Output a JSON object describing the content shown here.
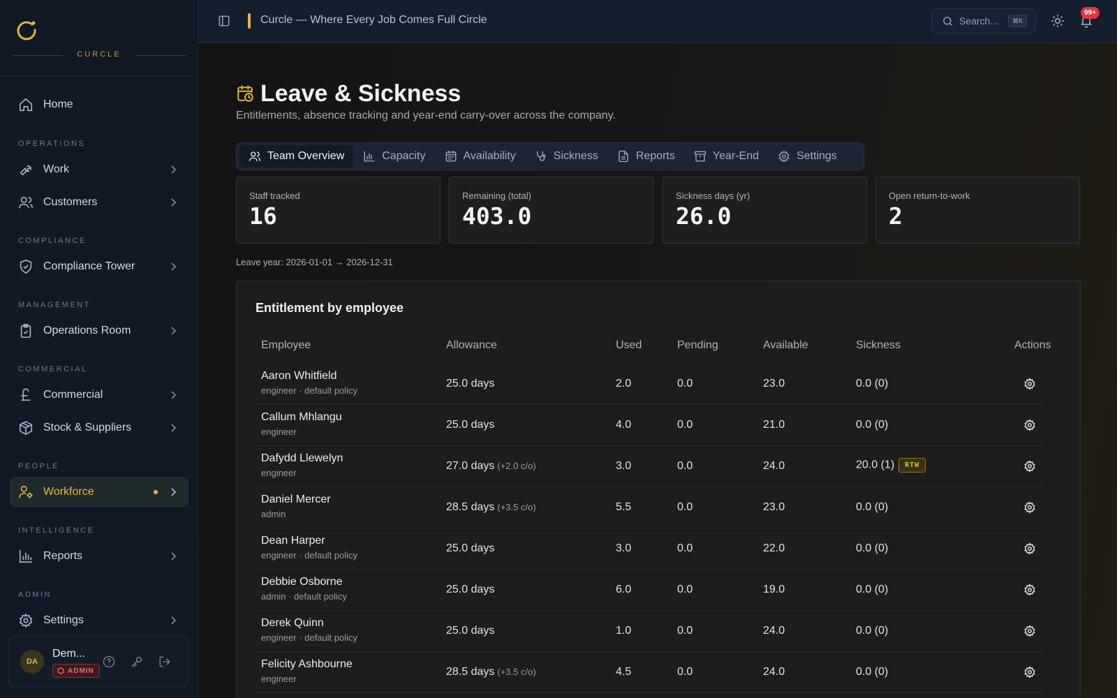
{
  "app": {
    "brand_name": "CURCLE",
    "window_title": "Curcle — Where Every Job Comes Full Circle"
  },
  "sidebar": {
    "home": "Home",
    "sections": {
      "operations": "OPERATIONS",
      "compliance": "COMPLIANCE",
      "management": "MANAGEMENT",
      "commercial": "COMMERCIAL",
      "people": "PEOPLE",
      "intelligence": "INTELLIGENCE",
      "admin": "ADMIN"
    },
    "items": {
      "work": "Work",
      "customers": "Customers",
      "compliance_tower": "Compliance Tower",
      "operations_room": "Operations Room",
      "commercial": "Commercial",
      "stock_suppliers": "Stock & Suppliers",
      "workforce": "Workforce",
      "reports": "Reports",
      "settings": "Settings"
    },
    "user": {
      "initials": "DA",
      "name": "Dem...",
      "role_badge": "ADMIN"
    }
  },
  "topbar": {
    "search_placeholder": "Search...",
    "search_shortcut": "⌘K",
    "notification_count": "99+"
  },
  "page": {
    "title": "Leave & Sickness",
    "subtitle": "Entitlements, absence tracking and year-end carry-over across the company.",
    "tabs": [
      "Team Overview",
      "Capacity",
      "Availability",
      "Sickness",
      "Reports",
      "Year-End",
      "Settings"
    ],
    "active_tab": "Team Overview",
    "stats": [
      {
        "label": "Staff tracked",
        "value": "16"
      },
      {
        "label": "Remaining (total)",
        "value": "403.0"
      },
      {
        "label": "Sickness days (yr)",
        "value": "26.0"
      },
      {
        "label": "Open return-to-work",
        "value": "2"
      }
    ],
    "leave_year": "Leave year: 2026-01-01 → 2026-12-31"
  },
  "table": {
    "title": "Entitlement by employee",
    "columns": {
      "employee": "Employee",
      "allowance": "Allowance",
      "used": "Used",
      "pending": "Pending",
      "available": "Available",
      "sickness": "Sickness",
      "actions": "Actions"
    },
    "rows": [
      {
        "name": "Aaron Whitfield",
        "role": "engineer · default policy",
        "allowance": "25.0 days",
        "carryover": "",
        "used": "2.0",
        "pending": "0.0",
        "available": "23.0",
        "sickness": "0.0 (0)",
        "rtw": ""
      },
      {
        "name": "Callum Mhlangu",
        "role": "engineer",
        "allowance": "25.0 days",
        "carryover": "",
        "used": "4.0",
        "pending": "0.0",
        "available": "21.0",
        "sickness": "0.0 (0)",
        "rtw": ""
      },
      {
        "name": "Dafydd Llewelyn",
        "role": "engineer",
        "allowance": "27.0 days",
        "carryover": "(+2.0 c/o)",
        "used": "3.0",
        "pending": "0.0",
        "available": "24.0",
        "sickness": "20.0 (1)",
        "rtw": "RTW"
      },
      {
        "name": "Daniel Mercer",
        "role": "admin",
        "allowance": "28.5 days",
        "carryover": "(+3.5 c/o)",
        "used": "5.5",
        "pending": "0.0",
        "available": "23.0",
        "sickness": "0.0 (0)",
        "rtw": ""
      },
      {
        "name": "Dean Harper",
        "role": "engineer · default policy",
        "allowance": "25.0 days",
        "carryover": "",
        "used": "3.0",
        "pending": "0.0",
        "available": "22.0",
        "sickness": "0.0 (0)",
        "rtw": ""
      },
      {
        "name": "Debbie Osborne",
        "role": "admin · default policy",
        "allowance": "25.0 days",
        "carryover": "",
        "used": "6.0",
        "pending": "0.0",
        "available": "19.0",
        "sickness": "0.0 (0)",
        "rtw": ""
      },
      {
        "name": "Derek Quinn",
        "role": "engineer · default policy",
        "allowance": "25.0 days",
        "carryover": "",
        "used": "1.0",
        "pending": "0.0",
        "available": "24.0",
        "sickness": "0.0 (0)",
        "rtw": ""
      },
      {
        "name": "Felicity Ashbourne",
        "role": "engineer",
        "allowance": "28.5 days",
        "carryover": "(+3.5 c/o)",
        "used": "4.5",
        "pending": "0.0",
        "available": "24.0",
        "sickness": "0.0 (0)",
        "rtw": ""
      }
    ]
  },
  "colors": {
    "accent": "#e3b63f",
    "sidebar_bg": "#111826",
    "topbar_bg": "#151e2d",
    "danger": "#e5333f"
  }
}
